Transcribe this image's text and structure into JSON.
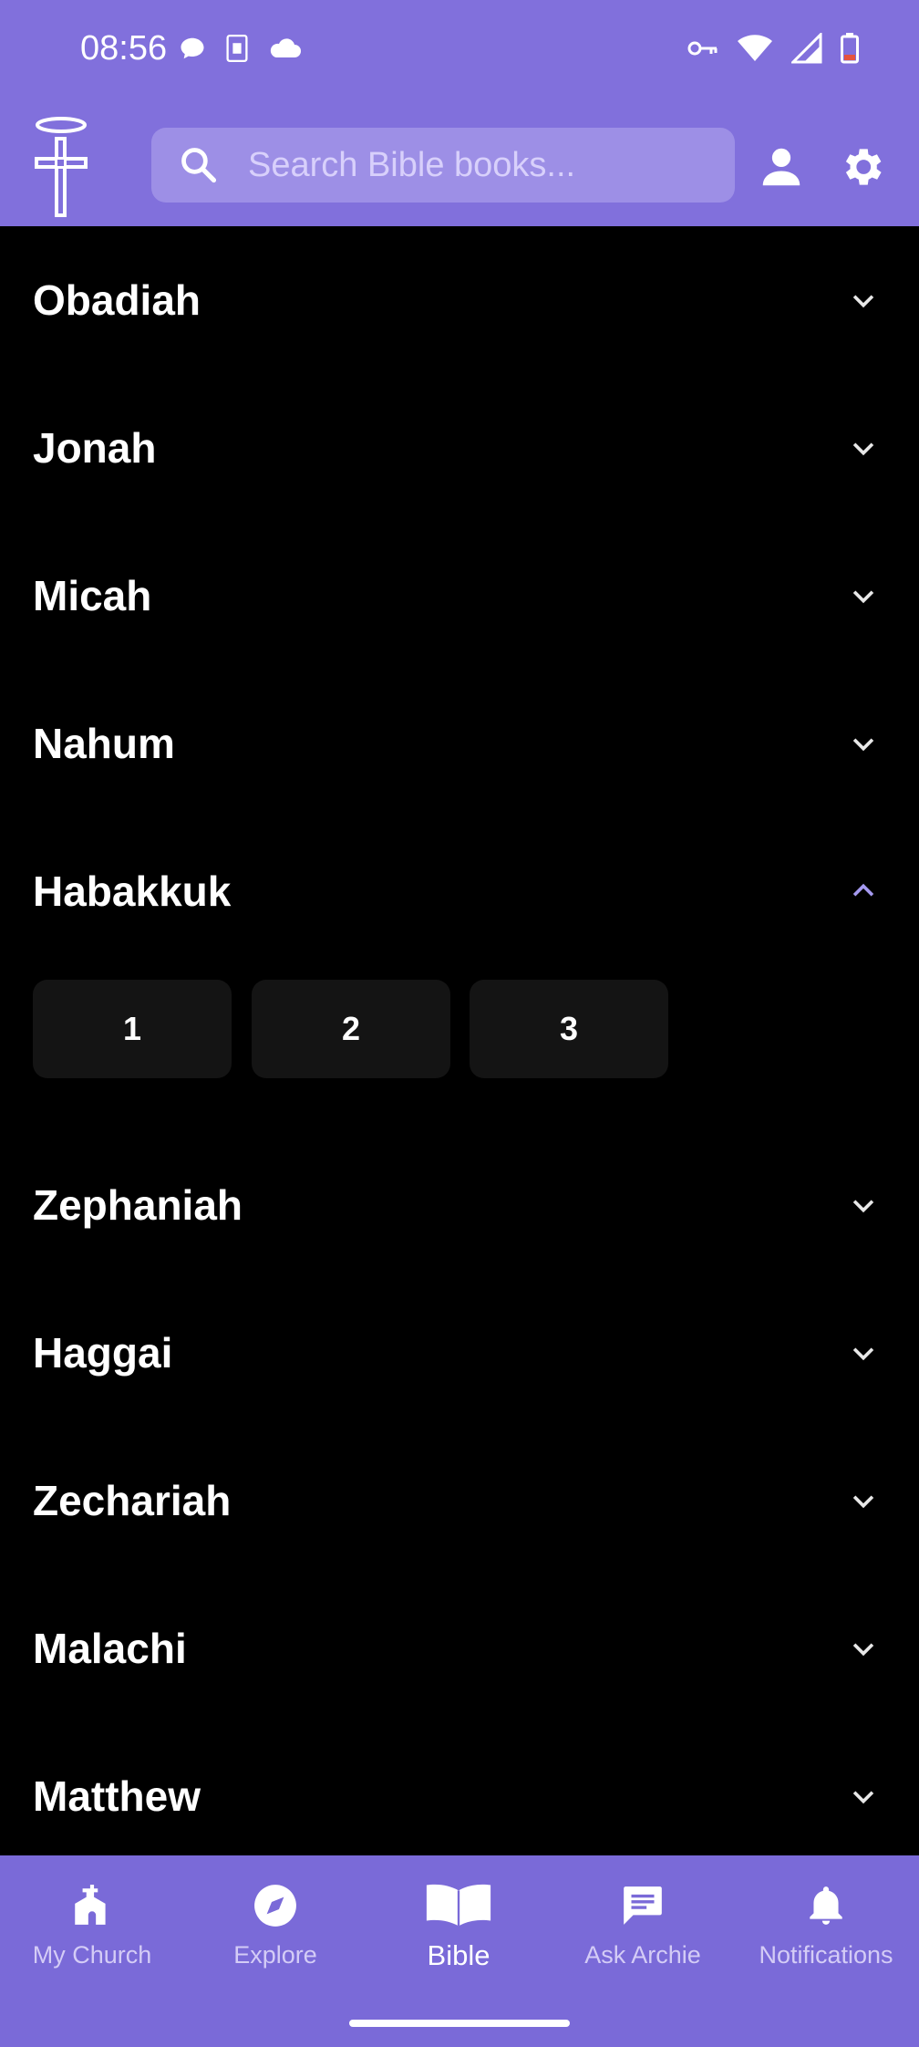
{
  "status_bar": {
    "time": "08:56",
    "left_icons": [
      "chat-bubble-icon",
      "sim-card-icon",
      "cloud-icon"
    ],
    "right_icons": [
      "vpn-key-icon",
      "wifi-icon",
      "signal-icon",
      "battery-low-icon"
    ]
  },
  "header": {
    "logo": "cross-halo-logo",
    "search": {
      "placeholder": "Search Bible books...",
      "value": ""
    }
  },
  "books": [
    {
      "name": "Obadiah",
      "expanded": false
    },
    {
      "name": "Jonah",
      "expanded": false
    },
    {
      "name": "Micah",
      "expanded": false
    },
    {
      "name": "Nahum",
      "expanded": false
    },
    {
      "name": "Habakkuk",
      "expanded": true,
      "chapters": [
        "1",
        "2",
        "3"
      ]
    },
    {
      "name": "Zephaniah",
      "expanded": false
    },
    {
      "name": "Haggai",
      "expanded": false
    },
    {
      "name": "Zechariah",
      "expanded": false
    },
    {
      "name": "Malachi",
      "expanded": false
    },
    {
      "name": "Matthew",
      "expanded": false
    }
  ],
  "bottom_nav": {
    "items": [
      {
        "label": "My Church",
        "icon": "church-icon"
      },
      {
        "label": "Explore",
        "icon": "compass-icon"
      },
      {
        "label": "Bible",
        "icon": "open-book-icon",
        "active": true
      },
      {
        "label": "Ask Archie",
        "icon": "chat-message-icon"
      },
      {
        "label": "Notifications",
        "icon": "bell-icon"
      }
    ]
  },
  "colors": {
    "header": "#8170dc",
    "nav": "#7a6ad8",
    "accent_chevron": "#a59af0",
    "background": "#000000",
    "chapter_button": "#141414"
  }
}
